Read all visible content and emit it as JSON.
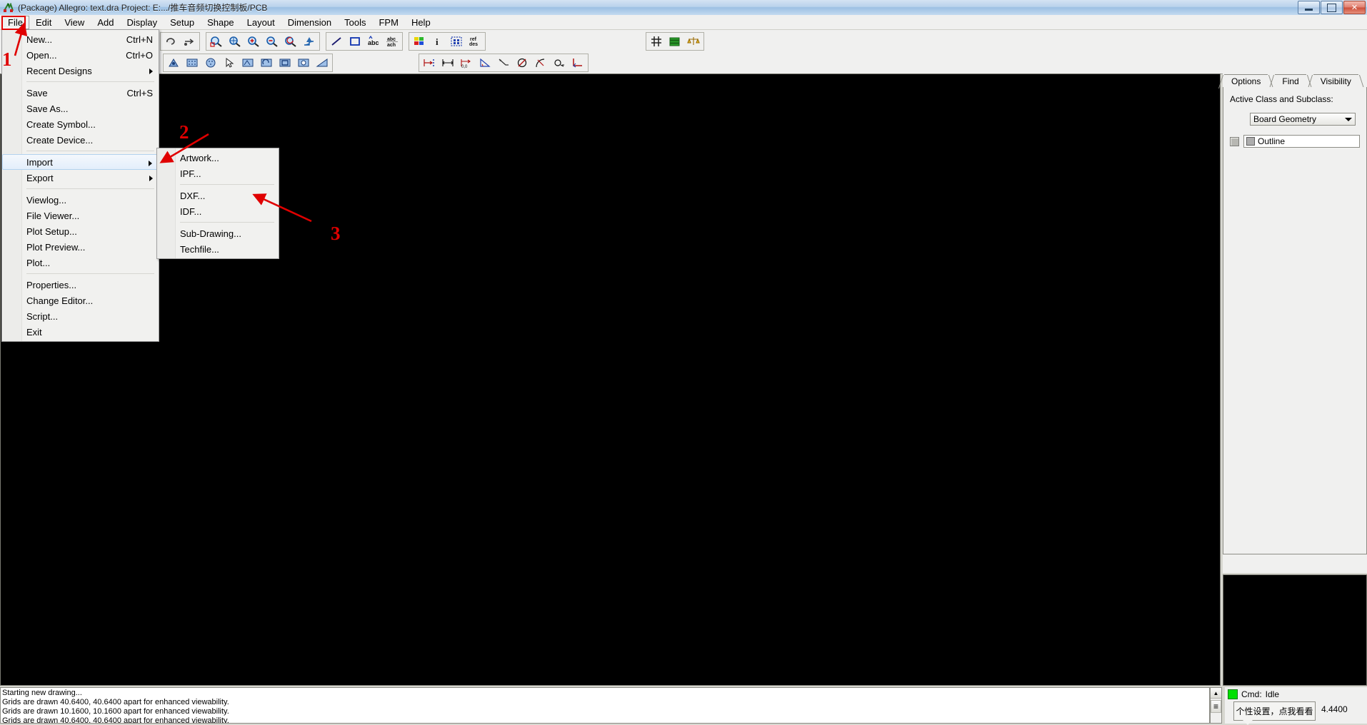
{
  "window": {
    "title": "(Package) Allegro: text.dra  Project: E:.../推车音频切换控制板/PCB",
    "icon": "allegro-icon",
    "minimize_label": "Minimize",
    "restore_label": "Restore",
    "close_label": "Close"
  },
  "menubar": {
    "items": [
      {
        "label": "File",
        "active": true
      },
      {
        "label": "Edit",
        "active": false
      },
      {
        "label": "View",
        "active": false
      },
      {
        "label": "Add",
        "active": false
      },
      {
        "label": "Display",
        "active": false
      },
      {
        "label": "Setup",
        "active": false
      },
      {
        "label": "Shape",
        "active": false
      },
      {
        "label": "Layout",
        "active": false
      },
      {
        "label": "Dimension",
        "active": false
      },
      {
        "label": "Tools",
        "active": false
      },
      {
        "label": "FPM",
        "active": false
      },
      {
        "label": "Help",
        "active": false
      }
    ]
  },
  "file_menu": {
    "items": [
      {
        "label": "New...",
        "accel": "Ctrl+N",
        "submenu": false,
        "highlight": false
      },
      {
        "label": "Open...",
        "accel": "Ctrl+O",
        "submenu": false,
        "highlight": false
      },
      {
        "label": "Recent Designs",
        "accel": "",
        "submenu": true,
        "highlight": false
      },
      {
        "separator": true
      },
      {
        "label": "Save",
        "accel": "Ctrl+S",
        "submenu": false,
        "highlight": false
      },
      {
        "label": "Save As...",
        "accel": "",
        "submenu": false,
        "highlight": false
      },
      {
        "label": "Create Symbol...",
        "accel": "",
        "submenu": false,
        "highlight": false
      },
      {
        "label": "Create Device...",
        "accel": "",
        "submenu": false,
        "highlight": false
      },
      {
        "separator": true
      },
      {
        "label": "Import",
        "accel": "",
        "submenu": true,
        "highlight": true
      },
      {
        "label": "Export",
        "accel": "",
        "submenu": true,
        "highlight": false
      },
      {
        "separator": true
      },
      {
        "label": "Viewlog...",
        "accel": "",
        "submenu": false,
        "highlight": false
      },
      {
        "label": "File Viewer...",
        "accel": "",
        "submenu": false,
        "highlight": false
      },
      {
        "label": "Plot Setup...",
        "accel": "",
        "submenu": false,
        "highlight": false
      },
      {
        "label": "Plot Preview...",
        "accel": "",
        "submenu": false,
        "highlight": false
      },
      {
        "label": "Plot...",
        "accel": "",
        "submenu": false,
        "highlight": false
      },
      {
        "separator": true
      },
      {
        "label": "Properties...",
        "accel": "",
        "submenu": false,
        "highlight": false
      },
      {
        "label": "Change Editor...",
        "accel": "",
        "submenu": false,
        "highlight": false
      },
      {
        "label": "Script...",
        "accel": "",
        "submenu": false,
        "highlight": false
      },
      {
        "label": "Exit",
        "accel": "",
        "submenu": false,
        "highlight": false
      }
    ]
  },
  "import_submenu": {
    "items": [
      {
        "label": "Artwork...",
        "separator": false
      },
      {
        "label": "IPF...",
        "separator": false
      },
      {
        "separator": true
      },
      {
        "label": "DXF...",
        "separator": false
      },
      {
        "label": "IDF...",
        "separator": false
      },
      {
        "separator": true
      },
      {
        "label": "Sub-Drawing...",
        "separator": false
      },
      {
        "label": "Techfile...",
        "separator": false
      }
    ]
  },
  "right_panel": {
    "tabs": [
      {
        "label": "Options",
        "selected": true
      },
      {
        "label": "Find",
        "selected": false
      },
      {
        "label": "Visibility",
        "selected": false
      }
    ],
    "section_label": "Active Class and Subclass:",
    "class_value": "Board Geometry",
    "subclass_value": "Outline"
  },
  "console": {
    "lines": [
      "Starting new drawing...",
      "Grids are drawn 40.6400, 40.6400 apart for enhanced viewability.",
      "Grids are drawn 10.1600, 10.1600 apart for enhanced viewability.",
      "Grids are drawn 40.6400, 40.6400 apart for enhanced viewability."
    ]
  },
  "status": {
    "cmd_label": "Cmd:",
    "cmd_value": "Idle",
    "coord_value": "4.4400",
    "tooltip": "个性设置，点我看看"
  },
  "annotations": {
    "step1": "1",
    "step2": "2",
    "step3": "3",
    "color": "#e00000"
  },
  "toolbar": {
    "row1_groups": [
      {
        "icons": [
          "undo-icon",
          "redo-icon"
        ]
      },
      {
        "icons": [
          "zoom-fit-icon",
          "zoom-world-icon",
          "zoom-in-icon",
          "zoom-out-icon",
          "zoom-previous-icon",
          "zoom-points-icon"
        ]
      },
      {
        "icons": [
          "add-line-icon",
          "add-rect-icon",
          "add-text-icon",
          "change-text-icon"
        ]
      },
      {
        "icons": [
          "color-layers-icon",
          "property-info-icon",
          "dim-box-icon",
          "refdes-icon"
        ]
      },
      {
        "icons": [
          "grid-toggle-icon",
          "layer-stack-icon",
          "constraints-icon"
        ]
      }
    ],
    "row2_groups": [
      {
        "icons": [
          "shape-add-icon",
          "shape-rect-icon",
          "shape-circle-icon",
          "select-arrow-icon",
          "shape-edit-icon",
          "shape-rotate-icon",
          "shape-box-icon",
          "shape-void-icon",
          "shape-fill-icon"
        ]
      },
      {
        "icons": [
          "dim-linear-icon",
          "dim-baseline-icon",
          "dim-datum-icon",
          "dim-angular-icon",
          "dim-leader-icon",
          "dim-diameter-icon",
          "dim-radius-icon",
          "dim-chamfer-icon",
          "dim-balloon-icon"
        ]
      }
    ]
  }
}
